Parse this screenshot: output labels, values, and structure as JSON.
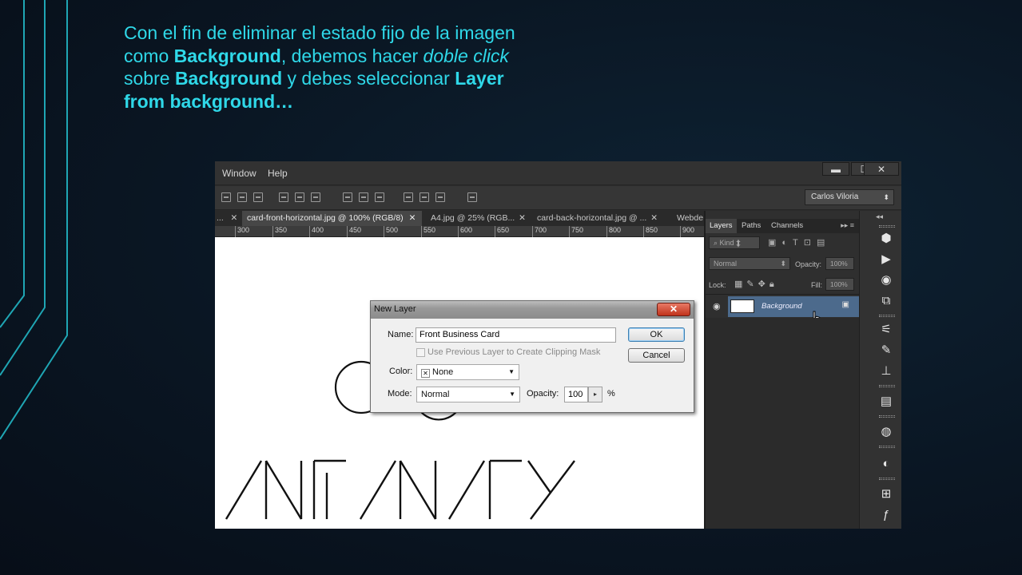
{
  "slide": {
    "text": {
      "p1": "Con el fin de eliminar el estado fijo de la imagen como ",
      "b1": "Background",
      "p2": ", debemos hacer ",
      "i1": "doble click",
      "p3": " sobre ",
      "b2": "Background",
      "p4": " y debes seleccionar ",
      "b3": "Layer from background…"
    },
    "accent_color": "#2fd8e8"
  },
  "photoshop": {
    "menu": {
      "window": "Window",
      "help": "Help"
    },
    "window_controls": {
      "minimize": "▬",
      "maximize": "☐",
      "close": "✕"
    },
    "user_dropdown": "Carlos Viloria",
    "tabs": [
      {
        "label": "...",
        "close": "✕"
      },
      {
        "label": "card-front-horizontal.jpg @ 100% (RGB/8)",
        "close": "✕"
      },
      {
        "label": "A4.jpg @ 25% (RGB...",
        "close": "✕"
      },
      {
        "label": "card-back-horizontal.jpg @ ...",
        "close": "✕"
      },
      {
        "label": "Webde"
      }
    ],
    "ruler_ticks": [
      "300",
      "350",
      "400",
      "450",
      "500",
      "550",
      "600",
      "650",
      "700",
      "750",
      "800",
      "850",
      "900"
    ],
    "canvas_text": "/NF/N/ΓY",
    "layers_panel": {
      "tabs": [
        "Layers",
        "Paths",
        "Channels"
      ],
      "kind_label": "Kind",
      "blend_mode": "Normal",
      "opacity_label": "Opacity:",
      "opacity_value": "100%",
      "lock_label": "Lock:",
      "fill_label": "Fill:",
      "fill_value": "100%",
      "layer_name": "Background"
    }
  },
  "dialog": {
    "title": "New Layer",
    "close": "✕",
    "name_label": "Name:",
    "name_value": "Front Business Card",
    "clipping_label": "Use Previous Layer to Create Clipping Mask",
    "color_label": "Color:",
    "color_value": "None",
    "color_swatch": "✕",
    "mode_label": "Mode:",
    "mode_value": "Normal",
    "opacity_label": "Opacity:",
    "opacity_value": "100",
    "opacity_unit": "%",
    "ok": "OK",
    "cancel": "Cancel"
  }
}
